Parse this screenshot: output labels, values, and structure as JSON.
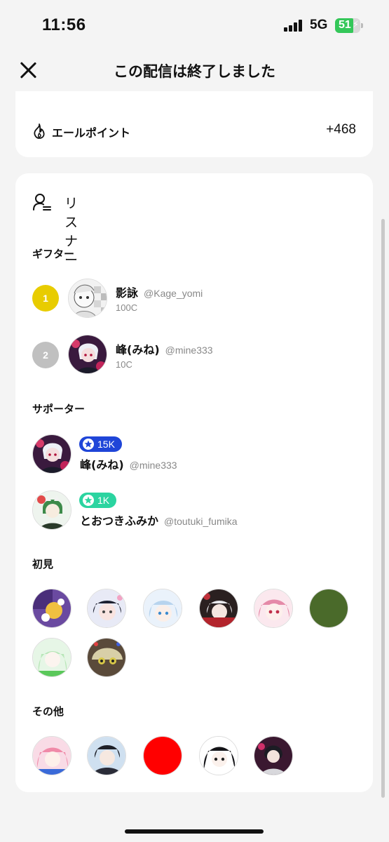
{
  "status": {
    "time": "11:56",
    "network": "5G",
    "battery": "51"
  },
  "header": {
    "title": "この配信は終了しました",
    "close_icon": "close-icon"
  },
  "yell": {
    "label": "エールポイント",
    "value": "+468",
    "icon": "flame-icon"
  },
  "listener": {
    "label": "リスナー",
    "icon": "person-list-icon"
  },
  "gifters": {
    "title": "ギフター",
    "items": [
      {
        "rank": "1",
        "rank_color": "#e8cc00",
        "name": "影詠",
        "handle": "@Kage_yomi",
        "coins": "100C"
      },
      {
        "rank": "2",
        "rank_color": "#c0c0c0",
        "name": "峰(みね)",
        "handle": "@mine333",
        "coins": "10C"
      }
    ]
  },
  "supporters": {
    "title": "サポーター",
    "items": [
      {
        "badge": "15K",
        "badge_color": "#1f45d8",
        "name": "峰(みね)",
        "handle": "@mine333"
      },
      {
        "badge": "1K",
        "badge_color": "#2bd4a0",
        "name": "とおつきふみか",
        "handle": "@toutuki_fumika"
      }
    ]
  },
  "first_time": {
    "title": "初見"
  },
  "others": {
    "title": "その他"
  },
  "colors": {
    "accent_blue": "#1f45d8",
    "accent_green": "#2bd4a0",
    "battery_green": "#34c759"
  }
}
